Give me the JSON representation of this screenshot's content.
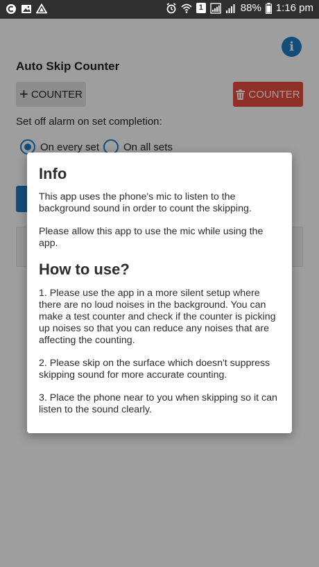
{
  "status_bar": {
    "battery": "88%",
    "time": "1:16 pm",
    "sim_badge": "1"
  },
  "header": {
    "title": "Auto Skip Counter",
    "info_label": "i"
  },
  "actions": {
    "add_label": "COUNTER",
    "delete_label": "COUNTER"
  },
  "alarm": {
    "label": "Set off alarm on set completion:",
    "options": [
      {
        "label": "On every set",
        "selected": true
      },
      {
        "label": "On all sets",
        "selected": false
      }
    ]
  },
  "dialog": {
    "info_title": "Info",
    "info_p1": "This app uses the phone's mic to listen to the background sound in order to count the skipping.",
    "info_p2": "Please allow this app to use the mic while using the app.",
    "howto_title": "How to use?",
    "step1": "1. Please use the app in a more silent setup where there are no loud noises in the background. You can make a test counter and check if the counter is picking up noises so that you can reduce any noises that are affecting the counting.",
    "step2": "2. Please skip on the surface which doesn't suppress skipping sound for more accurate counting.",
    "step3": "3. Place the phone near to you when skipping so it can listen to the sound clearly."
  },
  "colors": {
    "accent": "#1e7fc4",
    "danger": "#e74c3c",
    "status_bar": "#2f2f2f"
  }
}
